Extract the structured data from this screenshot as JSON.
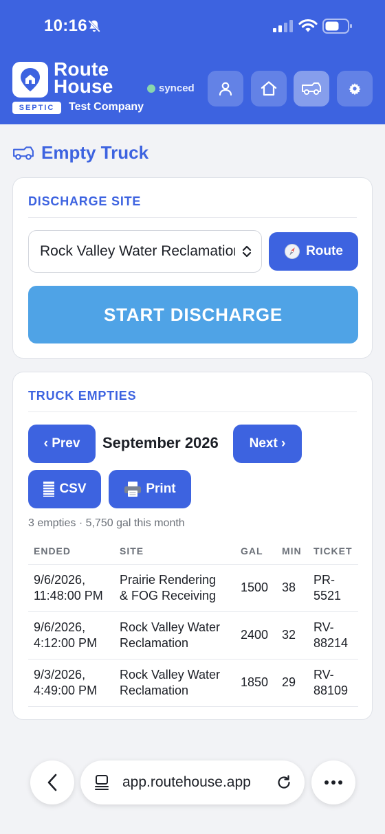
{
  "status_bar": {
    "time": "10:16"
  },
  "header": {
    "brand_line1": "Route",
    "brand_line2": "House",
    "badge": "SEPTIC",
    "company": "Test Company",
    "sync_status": "synced",
    "sync_color": "#89d6ad",
    "nav_icons": [
      "user-icon",
      "home-icon",
      "truck-icon",
      "gear-icon"
    ],
    "active_nav": "truck-icon",
    "brand_color": "#3d63e0"
  },
  "page": {
    "title": "Empty Truck",
    "title_icon": "truck-icon"
  },
  "discharge": {
    "heading": "DISCHARGE SITE",
    "selected_site": "Rock Valley Water Reclamation",
    "route_label": "Route",
    "route_icon": "compass-icon",
    "start_label": "START DISCHARGE",
    "start_color": "#4fa3e6"
  },
  "empties": {
    "heading": "TRUCK EMPTIES",
    "prev_label": "‹ Prev",
    "month": "September 2026",
    "next_label": "Next ›",
    "csv_label": "CSV",
    "print_label": "Print",
    "summary": "3 empties · 5,750 gal this month",
    "columns": [
      "ENDED",
      "SITE",
      "GAL",
      "MIN",
      "TICKET"
    ],
    "rows": [
      {
        "ended_date": "9/6/2026,",
        "ended_time": "11:48:00 PM",
        "site_line1": "Prairie Rendering",
        "site_line2": "& FOG Receiving",
        "gal": "1500",
        "min": "38",
        "ticket_line1": "PR-",
        "ticket_line2": "5521"
      },
      {
        "ended_date": "9/6/2026,",
        "ended_time": "4:12:00 PM",
        "site_line1": "Rock Valley Water",
        "site_line2": "Reclamation",
        "gal": "2400",
        "min": "32",
        "ticket_line1": "RV-",
        "ticket_line2": "88214"
      },
      {
        "ended_date": "9/3/2026,",
        "ended_time": "4:49:00 PM",
        "site_line1": "Rock Valley Water",
        "site_line2": "Reclamation",
        "gal": "1850",
        "min": "29",
        "ticket_line1": "RV-",
        "ticket_line2": "88109"
      }
    ]
  },
  "browser": {
    "url": "app.routehouse.app"
  }
}
